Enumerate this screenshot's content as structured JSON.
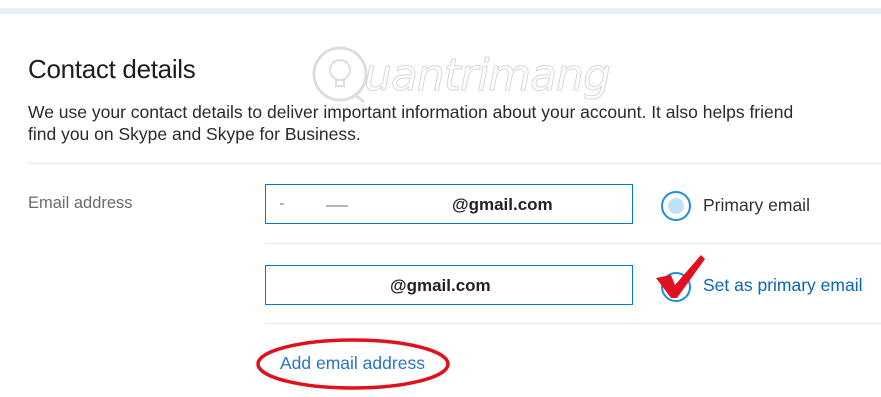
{
  "section": {
    "title": "Contact details",
    "description_line1": "We use your contact details to deliver important information about your account. It also helps friend",
    "description_line2": "find you on Skype and Skype for Business."
  },
  "email": {
    "label": "Email address",
    "entries": [
      {
        "value": "@gmail.com",
        "radio_label": "Primary email",
        "radio_state": "selected"
      },
      {
        "value": "@gmail.com",
        "radio_label": "Set as primary email",
        "radio_state": "unselected"
      }
    ],
    "add_link": "Add email address"
  },
  "colors": {
    "accent": "#0078d4",
    "link": "#2b74c2",
    "annotation_red": "#e0101e"
  },
  "watermark": {
    "text": "uantrimang"
  }
}
